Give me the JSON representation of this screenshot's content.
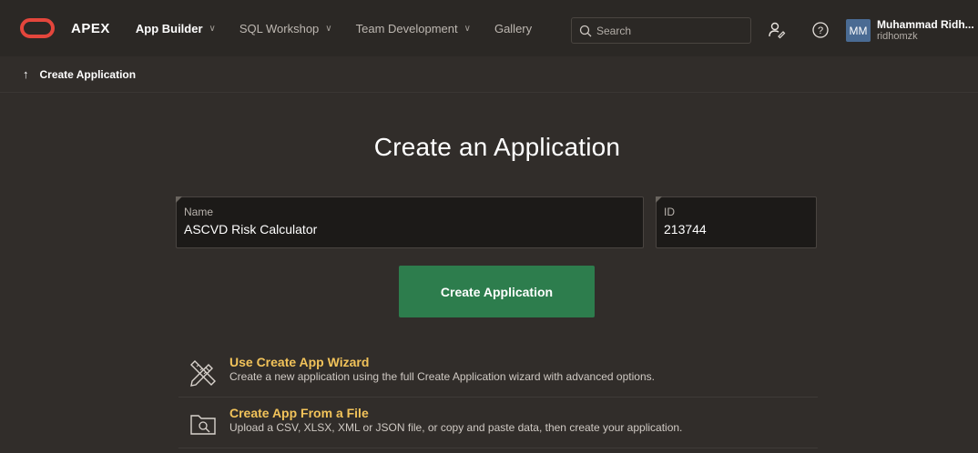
{
  "app": {
    "name": "APEX"
  },
  "nav": {
    "items": [
      {
        "label": "App Builder",
        "has_menu": true,
        "active": true
      },
      {
        "label": "SQL Workshop",
        "has_menu": true,
        "active": false
      },
      {
        "label": "Team Development",
        "has_menu": true,
        "active": false
      },
      {
        "label": "Gallery",
        "has_menu": false,
        "active": false
      }
    ],
    "search_placeholder": "Search",
    "icons": [
      "admin-user-icon",
      "help-icon"
    ]
  },
  "user": {
    "initials": "MM",
    "name": "Muhammad Ridh...",
    "username": "ridhomzk"
  },
  "breadcrumb": {
    "arrow": "↑",
    "label": "Create Application"
  },
  "page": {
    "title": "Create an Application",
    "name_field": {
      "label": "Name",
      "value": "ASCVD Risk Calculator"
    },
    "id_field": {
      "label": "ID",
      "value": "213744"
    },
    "create_button": "Create Application",
    "options": [
      {
        "icon": "wizard-pencil-ruler-icon",
        "title": "Use Create App Wizard",
        "description": "Create a new application using the full Create Application wizard with advanced options."
      },
      {
        "icon": "file-folder-search-icon",
        "title": "Create App From a File",
        "description": "Upload a CSV, XLSX, XML or JSON file, or copy and paste data, then create your application."
      }
    ]
  },
  "colors": {
    "background": "#312d2a",
    "topbar": "#2b2825",
    "accent_green": "#2d7d4d",
    "link_yellow": "#f2c35a",
    "oracle_red": "#e4463c",
    "avatar_blue": "#4a6b93"
  }
}
